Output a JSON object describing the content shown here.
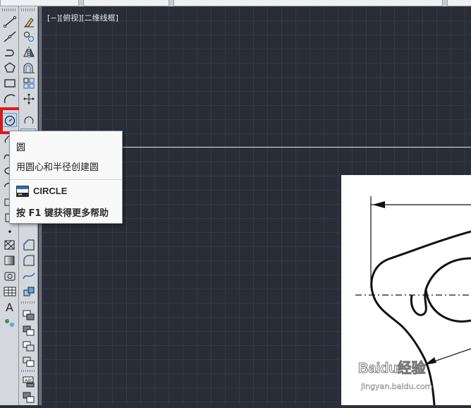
{
  "viewport": {
    "label": "[−][俯视][二维线框]"
  },
  "tooltip": {
    "title": "圆",
    "description": "用圆心和半径创建圆",
    "command": "CIRCLE",
    "help": "按 F1 键获得更多帮助"
  },
  "watermark": {
    "brand": "Baidu经验",
    "url": "jingyan.baidu.com"
  },
  "colors": {
    "canvas": "#282d38",
    "grid": "#343a47",
    "highlight": "#e0161a",
    "tooltip_bg": "#f9f9f9"
  },
  "toolbar_draw": {
    "icons": [
      "line-icon",
      "construction-line-icon",
      "polyline-icon",
      "polygon-icon",
      "rectangle-icon",
      "arc-icon",
      "circle-icon",
      "revision-cloud-icon",
      "spline-icon",
      "ellipse-icon",
      "ellipse-arc-icon",
      "insert-block-icon",
      "make-block-icon",
      "point-icon",
      "hatch-icon",
      "gradient-icon",
      "region-icon",
      "table-icon",
      "multiline-text-icon",
      "add-selected-icon"
    ]
  },
  "toolbar_modify": {
    "icons": [
      "erase-icon",
      "copy-icon",
      "mirror-icon",
      "offset-icon",
      "array-icon",
      "move-icon",
      "rotate-icon",
      "scale-icon",
      "stretch-icon",
      "trim-icon",
      "extend-icon",
      "break-icon",
      "join-icon",
      "chamfer-icon",
      "fillet-icon",
      "blend-icon",
      "explode-icon",
      "draworder-icon"
    ]
  }
}
